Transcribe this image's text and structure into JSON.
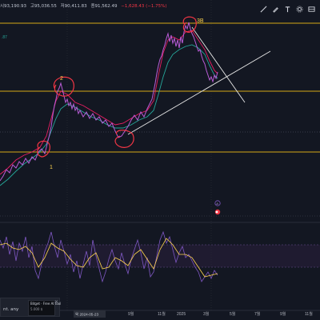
{
  "ohlc": {
    "o": "시93,190.93",
    "h": "고95,036.55",
    "l": "저90,411.83",
    "c": "종91,562.49",
    "chg": "−1,628.43 (−1.75%)"
  },
  "toolbar": {
    "icons": [
      "trend-line-icon",
      "pencil-icon",
      "text-icon",
      "settings-icon",
      "chart-type-icon"
    ]
  },
  "colors": {
    "background": "#131722",
    "level_line": "#d4a817",
    "price": "#9c27b0",
    "ma_fast": "#e91e63",
    "ma_slow": "#26a69a",
    "osc": "#7e57c2",
    "osc_signal": "#ffd54f",
    "annotation_circle": "#f23645",
    "annotation_label": "#ffd54f",
    "trend_line": "#ffffff"
  },
  "annotations": {
    "wave1": "1",
    "wave2": "2",
    "wave3b": "3B"
  },
  "levels_price": [
    {
      "name": "top",
      "label": ""
    },
    {
      "name": "mid",
      "label": ""
    },
    {
      "name": "low",
      "label": ""
    }
  ],
  "x_axis": {
    "ticks": [
      "9월",
      "11월",
      "2025",
      "3월",
      "5월",
      "7월",
      "9월",
      "11월"
    ],
    "date_label": "목 2024-05-23"
  },
  "indicator": {
    "label_left": ".87"
  },
  "alert_marker": {
    "label": "A"
  },
  "notification": {
    "text": "nt. any",
    "card_title": "Bitget · Free AI tool",
    "card_sub": "5.000 $",
    "close": "×"
  }
}
